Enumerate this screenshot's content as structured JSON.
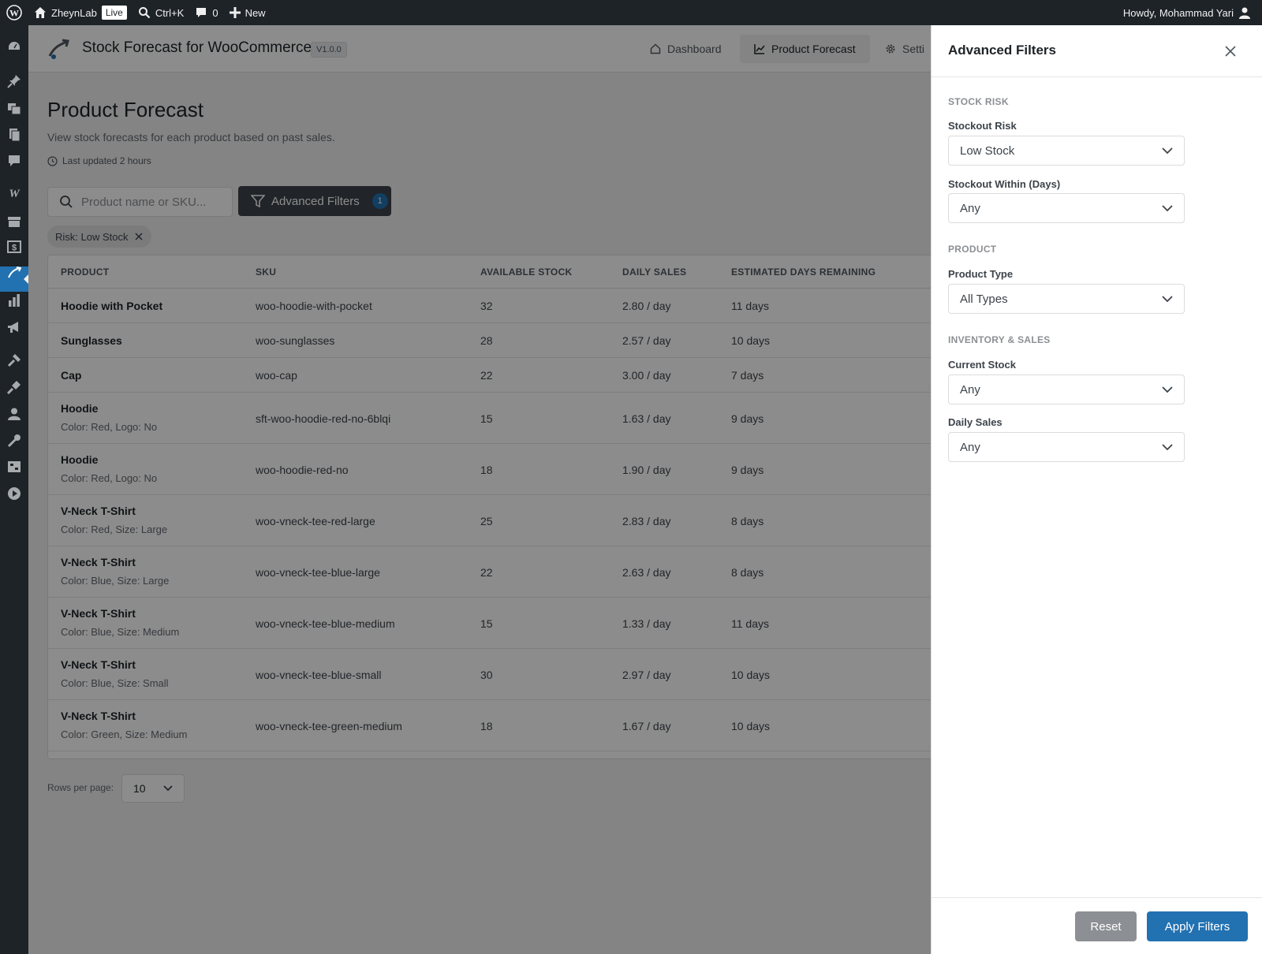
{
  "adminbar": {
    "site_name": "ZheynLab",
    "live_badge": "Live",
    "search_shortcut": "Ctrl+K",
    "comments_count": "0",
    "new_label": "New",
    "greeting": "Howdy, Mohammad Yari"
  },
  "sidebar": {
    "icons": [
      "dashboard-icon",
      "pin-icon",
      "media-icon",
      "pages-icon",
      "comments-icon",
      "woocommerce-icon",
      "products-icon",
      "payments-icon",
      "stock-forecast-icon",
      "analytics-icon",
      "marketing-icon",
      "appearance-icon",
      "plugins-icon",
      "users-icon",
      "tools-icon",
      "settings-icon",
      "play-icon"
    ],
    "active": "stock-forecast-icon"
  },
  "header": {
    "plugin_title": "Stock Forecast for WooCommerce",
    "version": "V1.0.0",
    "tabs": [
      {
        "label": "Dashboard",
        "icon": "home-icon",
        "active": false
      },
      {
        "label": "Product Forecast",
        "icon": "chart-icon",
        "active": true
      },
      {
        "label": "Setti",
        "icon": "gear-icon",
        "active": false
      }
    ]
  },
  "page": {
    "title": "Product Forecast",
    "description": "View stock forecasts for each product based on past sales.",
    "last_updated": "Last updated 2 hours"
  },
  "toolbar": {
    "search_placeholder": "Product name or SKU...",
    "advanced_filters_label": "Advanced Filters",
    "advanced_filters_count": "1",
    "active_chip": "Risk: Low Stock"
  },
  "table": {
    "headers": [
      "PRODUCT",
      "SKU",
      "AVAILABLE STOCK",
      "DAILY SALES",
      "ESTIMATED DAYS REMAINING"
    ],
    "rows": [
      {
        "name": "Hoodie with Pocket",
        "variation": "",
        "sku": "woo-hoodie-with-pocket",
        "stock": "32",
        "daily": "2.80 / day",
        "days": "11 days"
      },
      {
        "name": "Sunglasses",
        "variation": "",
        "sku": "woo-sunglasses",
        "stock": "28",
        "daily": "2.57 / day",
        "days": "10 days"
      },
      {
        "name": "Cap",
        "variation": "",
        "sku": "woo-cap",
        "stock": "22",
        "daily": "3.00 / day",
        "days": "7 days"
      },
      {
        "name": "Hoodie",
        "variation": "Color: Red, Logo: No",
        "sku": "sft-woo-hoodie-red-no-6blqi",
        "stock": "15",
        "daily": "1.63 / day",
        "days": "9 days"
      },
      {
        "name": "Hoodie",
        "variation": "Color: Red, Logo: No",
        "sku": "woo-hoodie-red-no",
        "stock": "18",
        "daily": "1.90 / day",
        "days": "9 days"
      },
      {
        "name": "V-Neck T-Shirt",
        "variation": "Color: Red, Size: Large",
        "sku": "woo-vneck-tee-red-large",
        "stock": "25",
        "daily": "2.83 / day",
        "days": "8 days"
      },
      {
        "name": "V-Neck T-Shirt",
        "variation": "Color: Blue, Size: Large",
        "sku": "woo-vneck-tee-blue-large",
        "stock": "22",
        "daily": "2.63 / day",
        "days": "8 days"
      },
      {
        "name": "V-Neck T-Shirt",
        "variation": "Color: Blue, Size: Medium",
        "sku": "woo-vneck-tee-blue-medium",
        "stock": "15",
        "daily": "1.33 / day",
        "days": "11 days"
      },
      {
        "name": "V-Neck T-Shirt",
        "variation": "Color: Blue, Size: Small",
        "sku": "woo-vneck-tee-blue-small",
        "stock": "30",
        "daily": "2.97 / day",
        "days": "10 days"
      },
      {
        "name": "V-Neck T-Shirt",
        "variation": "Color: Green, Size: Medium",
        "sku": "woo-vneck-tee-green-medium",
        "stock": "18",
        "daily": "1.67 / day",
        "days": "10 days"
      }
    ]
  },
  "pagination": {
    "rows_per_page_label": "Rows per page:",
    "rows_per_page_value": "10"
  },
  "drawer": {
    "title": "Advanced Filters",
    "sections": {
      "stock_risk": "STOCK RISK",
      "product": "PRODUCT",
      "inventory_sales": "INVENTORY & SALES"
    },
    "fields": {
      "stockout_risk_label": "Stockout Risk",
      "stockout_risk_value": "Low Stock",
      "stockout_within_label": "Stockout Within (Days)",
      "stockout_within_value": "Any",
      "product_type_label": "Product Type",
      "product_type_value": "All Types",
      "current_stock_label": "Current Stock",
      "current_stock_value": "Any",
      "daily_sales_label": "Daily Sales",
      "daily_sales_value": "Any"
    },
    "reset_label": "Reset",
    "apply_label": "Apply Filters"
  },
  "colors": {
    "adminbar_bg": "#1d2327",
    "primary": "#2271b1",
    "dark_button": "#3c434a",
    "reset_button": "#8c8f94"
  }
}
